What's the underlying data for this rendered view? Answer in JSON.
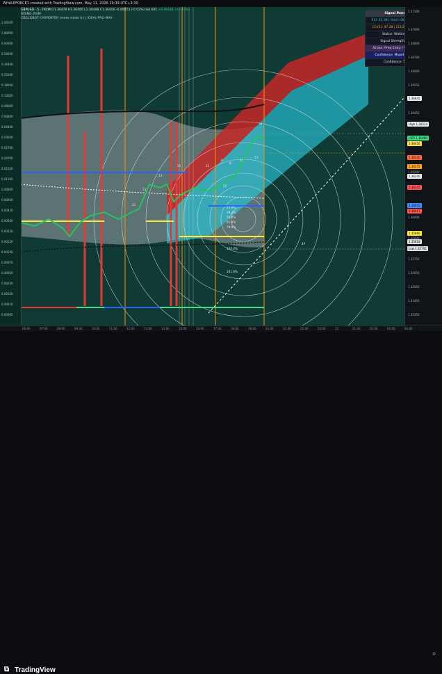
{
  "header": {
    "title": "WHALEFORCE1 created with TradingView.com, May 11, 2026 19:39 UTC+3:30"
  },
  "legend": {
    "symbol": "GBPUSD · 5 · FXCM",
    "ohlc": "O1.36479 H1.36480 L1.36448 C1.36456 -0.00023 (-0.02%)",
    "volume": "Vol 605",
    "change": "+0.00181 (+0.13%)",
    "row2": "RISING ZIGM",
    "row3": "CROCOBOT CARPENTER (meta inside it.) | IDEAL PRO-MAX"
  },
  "left_scale": [
    "1.00000",
    "1.80000",
    "0.90000",
    "0.54600",
    "0.34400",
    "0.25000",
    "0.18000",
    "0.13000",
    "0.09000",
    "0.06800",
    "0.04800",
    "0.03600",
    "0.02700",
    "0.02000",
    "0.01500",
    "0.01100",
    "0.00800",
    "0.00600",
    "0.00420",
    "0.00300",
    "0.00220",
    "0.00150",
    "0.00100",
    "0.00070",
    "0.00050",
    "0.00030",
    "0.00020",
    "0.00010",
    "0.00005",
    "0.00002"
  ],
  "right_scale": [
    "1.37200",
    "1.37000",
    "1.36800",
    "1.36700",
    "1.36600",
    "1.36550",
    "1.36450",
    "1.36400",
    "1.36350",
    "1.36300",
    "1.36250",
    "1.36200",
    "1.36150",
    "1.36100",
    "1.36050",
    "1.36000",
    "1.35950",
    "1.35900",
    "1.35850",
    "1.35800",
    "1.35750",
    "1.35700",
    "1.35650",
    "1.35600",
    "1.35550",
    "1.35500",
    "1.35450",
    "1.35400",
    "1.35350"
  ],
  "right_badges": [
    {
      "label": "1.36645",
      "color": "#e8eaed"
    },
    {
      "label": "High 1.36534",
      "color": "#e8eaed"
    },
    {
      "label": "CSPI  1.36480",
      "color": "#3ddc84"
    },
    {
      "label": "1.36456",
      "color": "#ffe14d"
    },
    {
      "label": "1.36330",
      "color": "#ff6e40"
    },
    {
      "label": "1.36275",
      "color": "#ffa726"
    },
    {
      "label": "1.36200",
      "color": "#eeeeee"
    },
    {
      "label": "1.36145",
      "color": "#ff5252"
    },
    {
      "label": "1.36045",
      "color": "#448aff"
    },
    {
      "label": "1.36017",
      "color": "#ff5252"
    },
    {
      "label": "1.35860",
      "color": "#ffeb3b"
    },
    {
      "label": "1.35818",
      "color": "#e0e0e0"
    },
    {
      "label": "Low 1.35792",
      "color": "#e0e0e0"
    }
  ],
  "x_axis": [
    "06:00",
    "07:00",
    "08:00",
    "09:00",
    "10:00",
    "11:00",
    "12:00",
    "13:00",
    "14:00",
    "15:00",
    "16:00",
    "17:00",
    "18:00",
    "19:00",
    "20:00",
    "21:00",
    "22:00",
    "23:00",
    "12",
    "01:00",
    "02:00",
    "03:00",
    "04:00"
  ],
  "fib_labels": [
    "23.6%",
    "38.2%",
    "50.0%",
    "61.8%",
    "78.6%",
    "100.0%",
    "161.8%",
    "4P"
  ],
  "wave_labels": [
    "21",
    "13",
    "13",
    "21",
    "21",
    "8",
    "8",
    "21",
    "34",
    "13",
    "1",
    "21",
    "55",
    "13",
    "8"
  ],
  "panel": {
    "title": "Signal Panel",
    "metrics": "RSI: 65.38 | Stoch SK: 6886.22",
    "cci": "CCI(5): 47.28 | CCI(20): 51.58",
    "status": "Status: Waiting...",
    "strength": "Signal Strength: 60",
    "action": "Action:  Prep Entry / Watchlist",
    "confidence_mixed": "Confidence:  Mixed Signals",
    "confidence_value": "Confidence: 50"
  },
  "footer": {
    "brand": "TradingView"
  },
  "colors": {
    "chart_bg": "#0f3b34",
    "red_band": "#c62828",
    "teal_band": "#26c6da",
    "grey_cloud": "#9aa3a8",
    "blue_line": "#2962ff",
    "yellow_line": "#ffeb3b",
    "orange_vline": "#ff8f00"
  }
}
